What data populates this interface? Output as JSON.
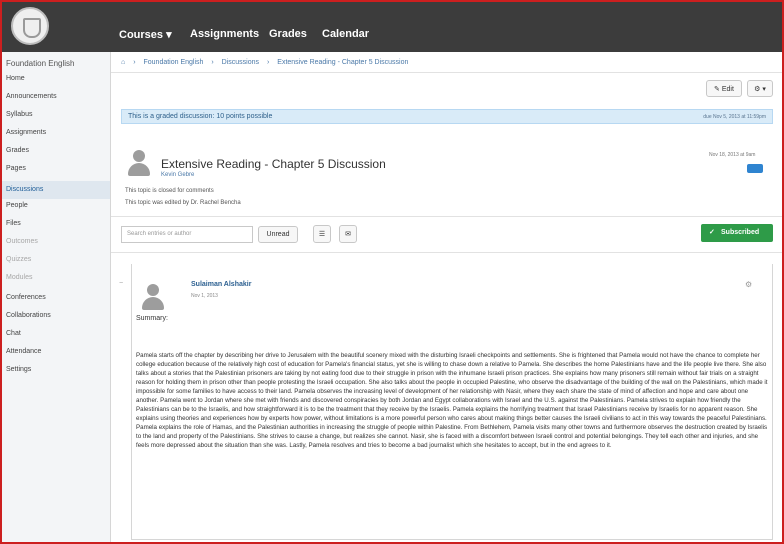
{
  "nav": {
    "courses": "Courses ▾",
    "assignments": "Assignments",
    "grades": "Grades",
    "calendar": "Calendar"
  },
  "sidebar": {
    "title": "Foundation English",
    "items": [
      {
        "label": "Home"
      },
      {
        "label": "Announcements"
      },
      {
        "label": "Syllabus"
      },
      {
        "label": "Assignments"
      },
      {
        "label": "Grades"
      },
      {
        "label": "Pages"
      },
      {
        "label": "Discussions"
      },
      {
        "label": "People"
      },
      {
        "label": "Files"
      },
      {
        "label": "Outcomes"
      },
      {
        "label": "Quizzes"
      },
      {
        "label": "Modules"
      },
      {
        "label": "Conferences"
      },
      {
        "label": "Collaborations"
      },
      {
        "label": "Chat"
      },
      {
        "label": "Attendance"
      },
      {
        "label": "Settings"
      }
    ]
  },
  "breadcrumb": {
    "home_icon": "home-icon",
    "items": [
      "Foundation English",
      "Discussions",
      "Extensive Reading - Chapter 5 Discussion"
    ]
  },
  "toolbar": {
    "edit_label": "Edit",
    "settings_label": "⚙ ▾"
  },
  "alert": {
    "message": "This is a graded discussion: 10 points possible",
    "due": "due Nov 5, 2013 at 11:59pm"
  },
  "topic": {
    "title": "Extensive Reading - Chapter 5 Discussion",
    "author": "Kevin Gebre",
    "locked_note": "This topic is closed for comments",
    "edited_note": "This topic was edited by Dr. Rachel Bencha",
    "date": "Nov 18, 2013 at 9am"
  },
  "controls": {
    "search_placeholder": "Search entries or author",
    "unread_label": "Unread",
    "subscribed_label": "Subscribed"
  },
  "reply": {
    "author": "Sulaiman Alshakir",
    "date": "Nov 1, 2013",
    "summary_label": "Summary:",
    "body": "Pamela starts off the chapter by describing her drive to Jerusalem with the beautiful scenery mixed with the disturbing Israeli checkpoints and settlements. She is frightened that Pamela would not have the chance to complete her college education because of the relatively high cost of education for Pamela's financial status, yet she is willing to chase down a relative to Pamela. She describes the home Palestinians have and the life people live there. She also talks about a stories that the Palestinian prisoners are taking by not eating food due to their struggle in prison with the inhumane Israeli prison practices. She explains how many prisoners still remain without fair trials on a straight reason for holding them in prison other than people protesting the Israeli occupation. She also talks about the people in occupied Palestine, who observe the disadvantage of the building of the wall on the Palestinians, which made it impossible for some families to have access to their land. Pamela observes the increasing level of development of her relationship with Nasir, where they each share the state of mind of affection and hope and care about one another. Pamela went to Jordan where she met with friends and discovered conspiracies by both Jordan and Egypt collaborations with Israel and the U.S. against the Palestinians. Pamela strives to explain how friendly the Palestinians can be to the Israelis, and how straightforward it is to be the treatment that they receive by the Israelis. Pamela explains the horrifying treatment that Israel Palestinians receive by Israelis for no apparent reason. She explains using theories and experiences how by experts how power, without limitations is a more powerful person who cares about making things better causes the Israeli civilians to act in this way towards the peaceful Palestinians. Pamela explains the role of Hamas, and the Palestinian authorities in increasing the struggle of people within Palestine. From Bethlehem, Pamela visits many other towns and furthermore observes the destruction created by Israelis to the land and property of the Palestinians. She strives to cause a change, but realizes she cannot. Nasir, she is faced with a discomfort between Israeli control and potential belongings. They tell each other and injuries, and she feels more depressed about the situation than she was. Lastly, Pamela resolves and tries to become a bad journalist which she hesitates to accept, but in the end agrees to it."
  }
}
